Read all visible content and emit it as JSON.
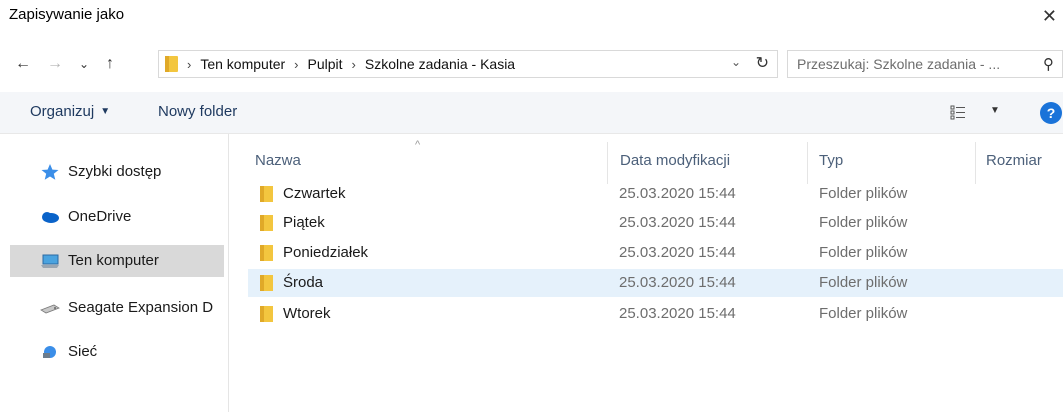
{
  "window": {
    "title": "Zapisywanie jako",
    "close_glyph": "✕"
  },
  "nav": {
    "back_glyph": "←",
    "forward_glyph": "→",
    "recent_glyph": "⌄",
    "up_glyph": "↑",
    "breadcrumb": [
      "Ten komputer",
      "Pulpit",
      "Szkolne zadania - Kasia"
    ],
    "dropdown_glyph": "⌄",
    "refresh_glyph": "↻",
    "search_placeholder": "Przeszukaj: Szkolne zadania - ...",
    "search_glyph": "⚲"
  },
  "toolbar": {
    "organize_label": "Organizuj",
    "organize_caret": "▼",
    "new_folder_label": "Nowy folder",
    "view_caret": "▼",
    "help_label": "?"
  },
  "sidebar": {
    "items": [
      {
        "label": "Szybki dostęp",
        "icon": "star-icon"
      },
      {
        "label": "OneDrive",
        "icon": "cloud-icon"
      },
      {
        "label": "Ten komputer",
        "icon": "computer-icon",
        "selected": true
      },
      {
        "label": "Seagate Expansion D",
        "icon": "drive-icon"
      },
      {
        "label": "Sieć",
        "icon": "network-icon"
      }
    ]
  },
  "columns": {
    "name": "Nazwa",
    "date": "Data modyfikacji",
    "type": "Typ",
    "size": "Rozmiar",
    "sort_glyph": "^"
  },
  "files": [
    {
      "name": "Czwartek",
      "date": "25.03.2020 15:44",
      "type": "Folder plików"
    },
    {
      "name": "Piątek",
      "date": "25.03.2020 15:44",
      "type": "Folder plików"
    },
    {
      "name": "Poniedziałek",
      "date": "25.03.2020 15:44",
      "type": "Folder plików"
    },
    {
      "name": "Środa",
      "date": "25.03.2020 15:44",
      "type": "Folder plików",
      "selected": true
    },
    {
      "name": "Wtorek",
      "date": "25.03.2020 15:44",
      "type": "Folder plików"
    }
  ],
  "colors": {
    "accent": "#1a73d9",
    "folder": "#f3c63f",
    "selected_row": "#e5f1fb",
    "selected_side": "#d9d9d9"
  }
}
